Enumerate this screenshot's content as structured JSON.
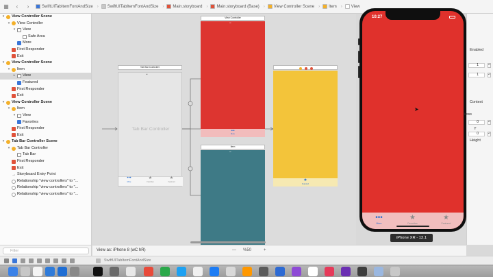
{
  "jumpbar": {
    "crumbs": [
      {
        "label": "SwiftUITabItemFontAndSize",
        "color": "#3a76d8"
      },
      {
        "label": "SwiftUITabItemFontAndSize",
        "color": "#c7c7c7"
      },
      {
        "label": "Main.storyboard",
        "color": "#e0523a"
      },
      {
        "label": "Main.storyboard (Base)",
        "color": "#e0523a"
      },
      {
        "label": "View Controller Scene",
        "color": "#f3b02a"
      },
      {
        "label": "Item",
        "color": "#f3b02a"
      },
      {
        "label": "View",
        "color": "#ffffff"
      }
    ]
  },
  "outline": {
    "rows": [
      {
        "label": "View Controller Scene",
        "type": "scene",
        "icon": "yellow-icon",
        "indent": 0
      },
      {
        "label": "View Controller",
        "type": "item",
        "icon": "yellow-icon",
        "indent": 1
      },
      {
        "label": "View",
        "type": "item",
        "icon": "white-icon",
        "indent": 2
      },
      {
        "label": "Safe Area",
        "type": "item",
        "icon": "white-icon",
        "indent": 3
      },
      {
        "label": "More",
        "type": "item",
        "icon": "blue-icon",
        "indent": 2
      },
      {
        "label": "First Responder",
        "type": "item",
        "icon": "red-icon",
        "indent": 1
      },
      {
        "label": "Exit",
        "type": "item",
        "icon": "red-icon",
        "indent": 1
      },
      {
        "label": "View Controller Scene",
        "type": "scene",
        "icon": "yellow-icon",
        "indent": 0
      },
      {
        "label": "Item",
        "type": "item",
        "icon": "yellow-icon",
        "indent": 1
      },
      {
        "label": "View",
        "type": "item",
        "icon": "white-icon",
        "indent": 2,
        "selected": true
      },
      {
        "label": "Featured",
        "type": "item",
        "icon": "blue-icon",
        "indent": 2
      },
      {
        "label": "First Responder",
        "type": "item",
        "icon": "red-icon",
        "indent": 1
      },
      {
        "label": "Exit",
        "type": "item",
        "icon": "red-icon",
        "indent": 1
      },
      {
        "label": "View Controller Scene",
        "type": "scene",
        "icon": "yellow-icon",
        "indent": 0
      },
      {
        "label": "Item",
        "type": "item",
        "icon": "yellow-icon",
        "indent": 1
      },
      {
        "label": "View",
        "type": "item",
        "icon": "white-icon",
        "indent": 2
      },
      {
        "label": "Favorites",
        "type": "item",
        "icon": "blue-icon",
        "indent": 2
      },
      {
        "label": "First Responder",
        "type": "item",
        "icon": "red-icon",
        "indent": 1
      },
      {
        "label": "Exit",
        "type": "item",
        "icon": "red-icon",
        "indent": 1
      },
      {
        "label": "Tab Bar Controller Scene",
        "type": "scene",
        "icon": "yellow-icon",
        "indent": 0
      },
      {
        "label": "Tab Bar Controller",
        "type": "item",
        "icon": "yellow-icon",
        "indent": 1
      },
      {
        "label": "Tab Bar",
        "type": "item",
        "icon": "white-icon",
        "indent": 2
      },
      {
        "label": "First Responder",
        "type": "item",
        "icon": "red-icon",
        "indent": 1
      },
      {
        "label": "Exit",
        "type": "item",
        "icon": "red-icon",
        "indent": 1
      },
      {
        "label": "Storyboard Entry Point",
        "type": "item",
        "icon": "arrow-icon",
        "indent": 1
      },
      {
        "label": "Relationship \"view controllers\" to \"...",
        "type": "item",
        "icon": "ring-icon",
        "indent": 1
      },
      {
        "label": "Relationship \"view controllers\" to \"...",
        "type": "item",
        "icon": "ring-icon",
        "indent": 1
      },
      {
        "label": "Relationship \"view controllers\" to \"...",
        "type": "item",
        "icon": "ring-icon",
        "indent": 1
      }
    ],
    "filter_placeholder": "Filter"
  },
  "canvas": {
    "tab_bar_controller": {
      "title": "Tab Bar Controller",
      "placeholder_label": "Tab Bar Controller",
      "tabs": [
        {
          "glyph": "•••",
          "label": "More",
          "active": true
        },
        {
          "glyph": "★",
          "label": "Favorites"
        },
        {
          "glyph": "★",
          "label": "Featured"
        }
      ]
    },
    "vc_red": {
      "title": "View Controller",
      "color": "#dd3530",
      "tab_glyph": "•••",
      "tab_label": "More"
    },
    "vc_teal": {
      "title": "Item",
      "color": "#3e7a86"
    },
    "vc_yellow": {
      "color": "#f3c43a",
      "tab_glyph": "★",
      "tab_label": "Featured"
    }
  },
  "simulator": {
    "time": "10:27",
    "screen_color": "#e0312c",
    "tabs": [
      {
        "glyph": "•••",
        "label": "More",
        "active": true
      },
      {
        "glyph": "★",
        "label": "Favorites"
      },
      {
        "glyph": "★",
        "label": "Featured"
      }
    ],
    "device_label": "iPhone XR - 12.1"
  },
  "inspector": {
    "enabled_label": "Enabled",
    "value1": "1",
    "value2": "1",
    "context_label": "Context",
    "views_label": "iews",
    "y_label": "Y",
    "value3": "0",
    "value4": "0",
    "height_label": "Height"
  },
  "bottombar": {
    "view_as": "View as: iPhone 8 (wC hR)",
    "zoom_out": "—",
    "zoom_level": "%50",
    "zoom_in": "+"
  },
  "debugbar": {
    "target_label": "SwiftUITabItemFontAndSize"
  }
}
